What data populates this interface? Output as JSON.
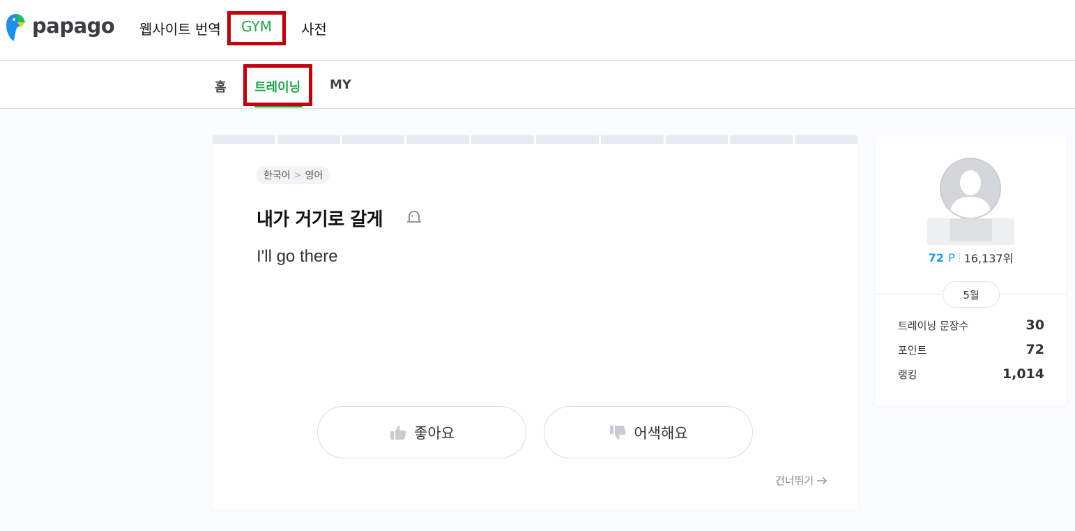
{
  "header": {
    "logo_text": "papago",
    "nav": [
      {
        "label": "웹사이트 번역"
      },
      {
        "label": "GYM"
      },
      {
        "label": "사전"
      }
    ]
  },
  "subnav": {
    "items": [
      {
        "label": "홈"
      },
      {
        "label": "트레이닝"
      },
      {
        "label": "MY"
      }
    ]
  },
  "training": {
    "progress_segments": 10,
    "lang_from": "한국어",
    "lang_sep": ">",
    "lang_to": "영어",
    "source_text": "내가 거기로 갈게",
    "report_icon": "siren-icon",
    "target_text": "I'll go there",
    "like_label": "좋아요",
    "dislike_label": "어색해요",
    "skip_label": "건너뛰기"
  },
  "profile": {
    "points_value": "72",
    "points_unit": "P",
    "rank": "16,137위",
    "month": "5월",
    "stats": [
      {
        "label": "트레이닝 문장수",
        "value": "30"
      },
      {
        "label": "포인트",
        "value": "72"
      },
      {
        "label": "랭킹",
        "value": "1,014"
      }
    ]
  },
  "colors": {
    "accent_green": "#1ba84c",
    "points_blue": "#1a9ef0",
    "highlight_red": "#c4000b"
  }
}
